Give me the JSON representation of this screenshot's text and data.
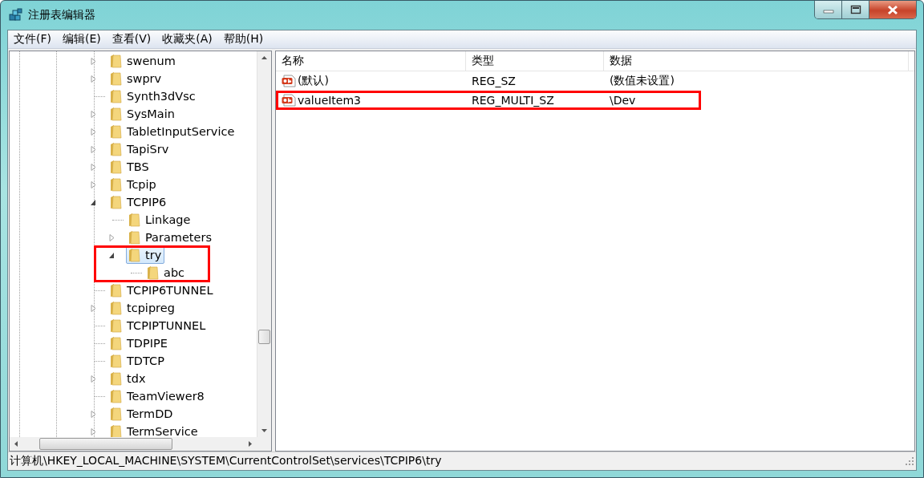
{
  "window": {
    "title": "注册表编辑器"
  },
  "menu": [
    "文件(F)",
    "编辑(E)",
    "查看(V)",
    "收藏夹(A)",
    "帮助(H)"
  ],
  "tree": [
    {
      "label": "swenum",
      "expanded": false,
      "selected": false
    },
    {
      "label": "swprv",
      "expanded": false,
      "selected": false
    },
    {
      "label": "Synth3dVsc",
      "selected": false
    },
    {
      "label": "SysMain",
      "expanded": false,
      "selected": false
    },
    {
      "label": "TabletInputService",
      "expanded": false,
      "selected": false
    },
    {
      "label": "TapiSrv",
      "expanded": false,
      "selected": false
    },
    {
      "label": "TBS",
      "expanded": false,
      "selected": false
    },
    {
      "label": "Tcpip",
      "expanded": false,
      "selected": false
    },
    {
      "label": "TCPIP6",
      "expanded": true,
      "selected": false,
      "children": [
        {
          "label": "Linkage",
          "selected": false
        },
        {
          "label": "Parameters",
          "expanded": false,
          "selected": false
        },
        {
          "label": "try",
          "expanded": true,
          "selected": true,
          "highlighted": true,
          "children": [
            {
              "label": "abc",
              "selected": false
            }
          ]
        }
      ]
    },
    {
      "label": "TCPIP6TUNNEL",
      "selected": false
    },
    {
      "label": "tcpipreg",
      "expanded": false,
      "selected": false
    },
    {
      "label": "TCPIPTUNNEL",
      "selected": false
    },
    {
      "label": "TDPIPE",
      "selected": false
    },
    {
      "label": "TDTCP",
      "selected": false
    },
    {
      "label": "tdx",
      "expanded": false,
      "selected": false
    },
    {
      "label": "TeamViewer8",
      "selected": false
    },
    {
      "label": "TermDD",
      "expanded": false,
      "selected": false
    },
    {
      "label": "TermService",
      "expanded": false,
      "selected": false
    }
  ],
  "values": {
    "columns": [
      "名称",
      "类型",
      "数据"
    ],
    "rows": [
      {
        "name": "(默认)",
        "type": "REG_SZ",
        "data": "(数值未设置)",
        "highlighted": false
      },
      {
        "name": "valueItem3",
        "type": "REG_MULTI_SZ",
        "data": "\\Dev",
        "highlighted": true
      }
    ]
  },
  "status_bar": "计算机\\HKEY_LOCAL_MACHINE\\SYSTEM\\CurrentControlSet\\services\\TCPIP6\\try"
}
